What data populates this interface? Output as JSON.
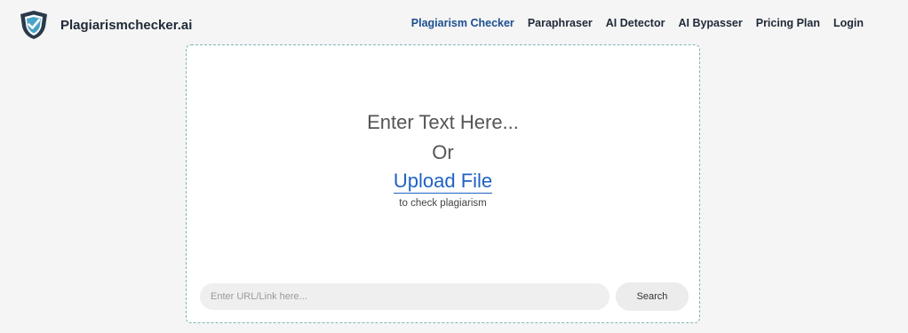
{
  "brand": {
    "name": "Plagiarismchecker.ai",
    "logo_icon": "shield-check-icon"
  },
  "nav": {
    "items": [
      {
        "label": "Plagiarism Checker",
        "active": true
      },
      {
        "label": "Paraphraser",
        "active": false
      },
      {
        "label": "AI Detector",
        "active": false
      },
      {
        "label": "AI Bypasser",
        "active": false
      },
      {
        "label": "Pricing Plan",
        "active": false
      },
      {
        "label": "Login",
        "active": false
      }
    ]
  },
  "editor": {
    "prompt": "Enter Text Here...",
    "or_label": "Or",
    "upload_label": "Upload File",
    "subtitle": "to check plagiarism"
  },
  "url_search": {
    "placeholder": "Enter URL/Link here...",
    "value": "",
    "button_label": "Search"
  },
  "colors": {
    "accent": "#1d4f91",
    "link": "#1f62c4",
    "logo_dark": "#2b3a4a",
    "logo_teal": "#4aa3c8",
    "card_border": "#7fb3b5",
    "page_bg": "#f5f5f5"
  }
}
